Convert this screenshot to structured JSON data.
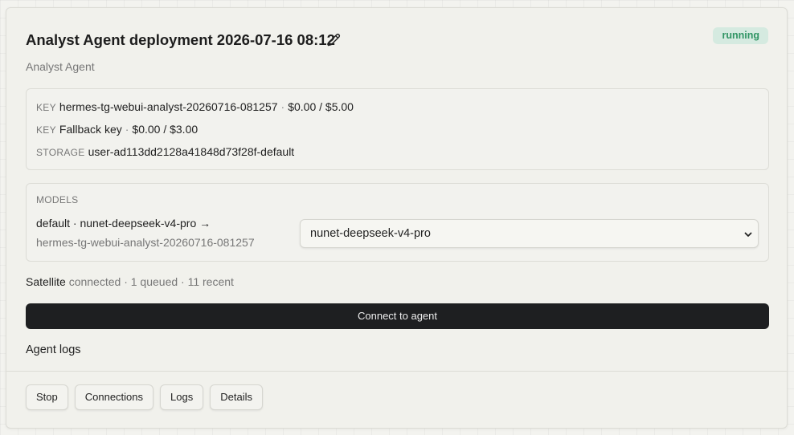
{
  "deployment": {
    "title": "Analyst Agent deployment 2026-07-16 08:12",
    "status": "running",
    "subtitle": "Analyst Agent"
  },
  "info": {
    "key1_label": "KEY",
    "key1_value": "hermes-tg-webui-analyst-20260716-081257",
    "key1_separator": "·",
    "key1_budget": "$0.00 / $5.00",
    "key2_label": "KEY",
    "key2_value": "Fallback key",
    "key2_separator": "·",
    "key2_budget": "$0.00 / $3.00",
    "storage_label": "STORAGE",
    "storage_value": "user-ad113dd2128a41848d73f28f-default"
  },
  "models": {
    "label": "MODELS",
    "mapping_line1": "default · nunet-deepseek-v4-pro →",
    "mapping_line2": "hermes-tg-webui-analyst-20260716-081257",
    "selected": "nunet-deepseek-v4-pro"
  },
  "satellite": {
    "name": "Satellite",
    "status": "connected · 1 queued · 11 recent"
  },
  "connect_label": "Connect to agent",
  "logs_title": "Agent logs",
  "actions": {
    "stop": "Stop",
    "connections": "Connections",
    "logs": "Logs",
    "details": "Details"
  },
  "colors": {
    "status_bg": "#d5eae0",
    "status_text": "#2f9463",
    "primary_button": "#1e1f21"
  },
  "icons": {
    "edit": "pencil-icon",
    "select": "chevron-down-icon"
  }
}
